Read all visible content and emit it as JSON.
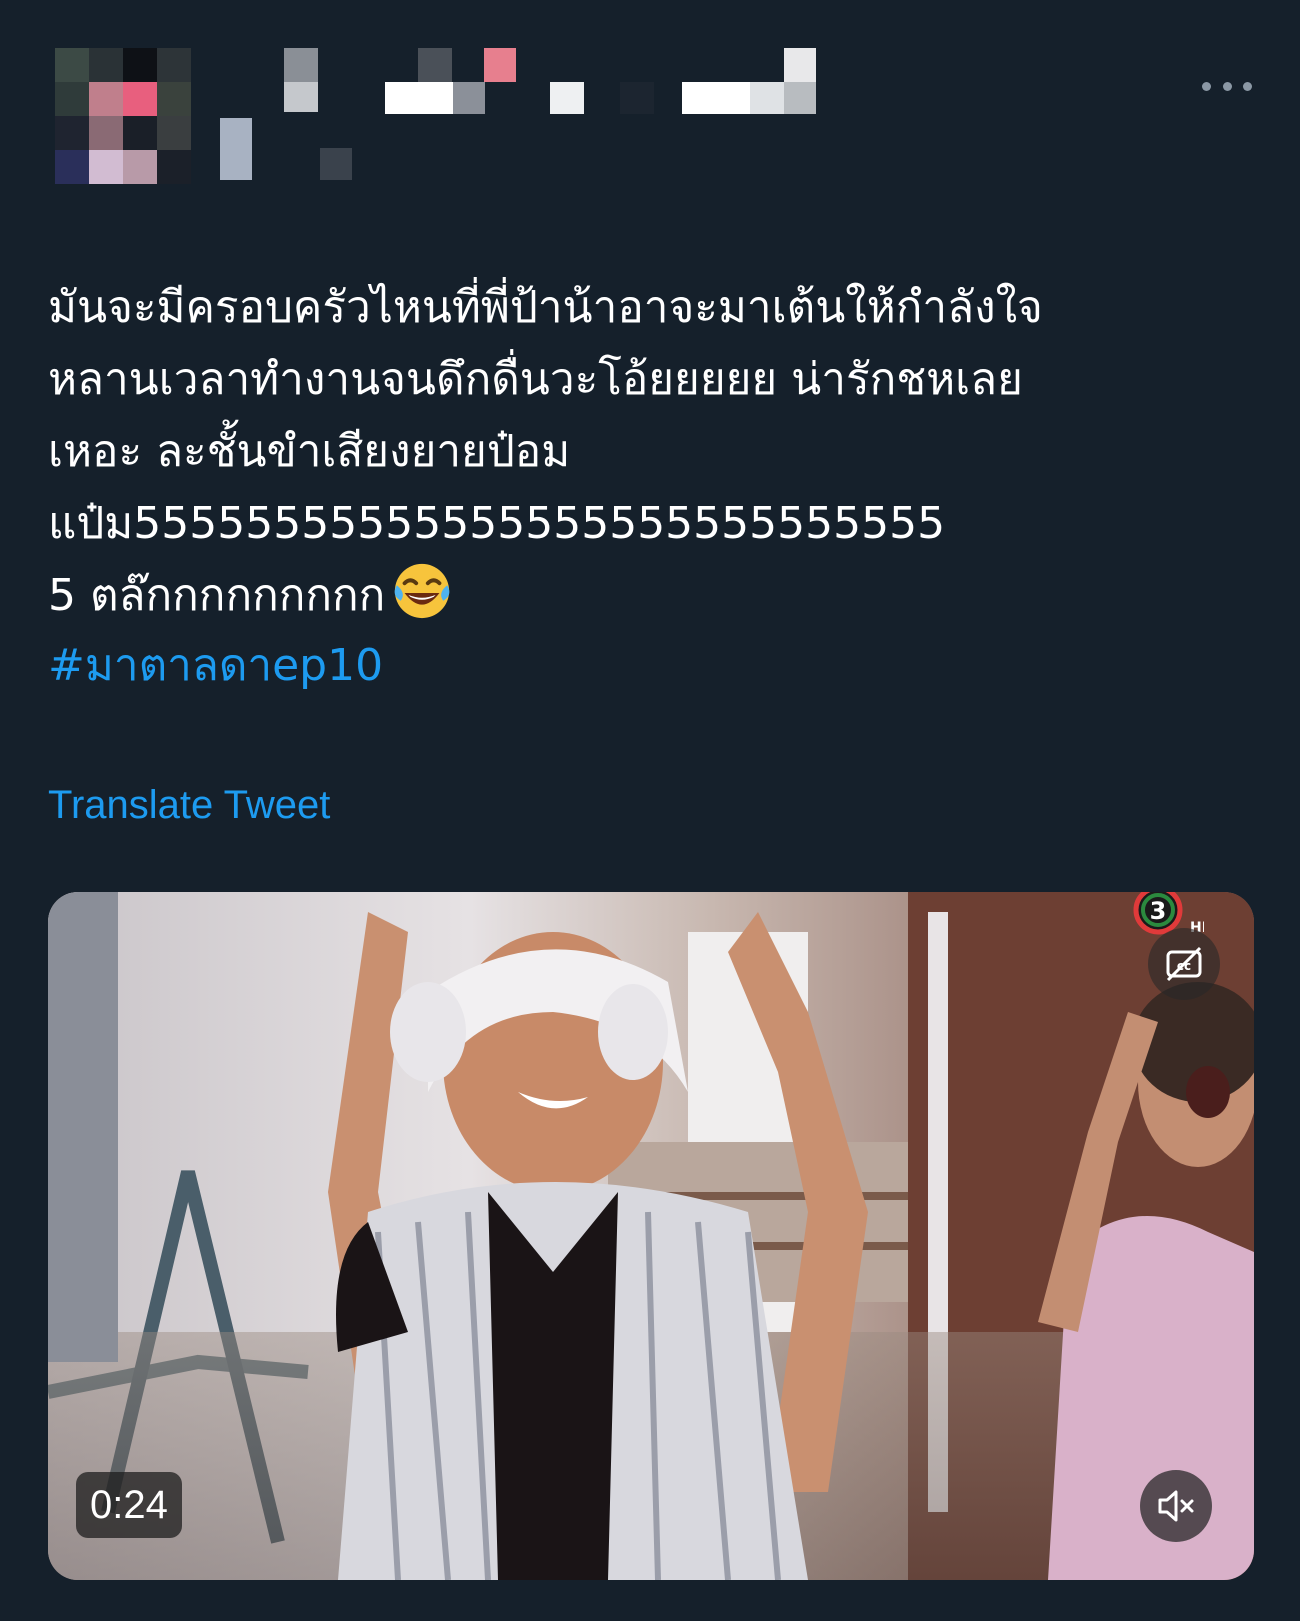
{
  "tweet": {
    "text": "มันจะมีครอบครัวไหนที่พี่ป้าน้าอาจะมาเต้นให้กำลังใจ\nหลานเวลาทำงานจนดึกดื่นวะโอ้ยยยยย น่ารักชหเลย\nเหอะ ละชั้นขำเสียงยายป๋อม\nแป๋ม55555555555555555555555555555\n5 ตล๊กกกกกกกกก",
    "emoji": "face-with-tears-of-joy",
    "hashtag": "#มาตาลดาep10",
    "translate_label": "Translate Tweet",
    "more_icon": "more-horizontal-icon"
  },
  "video": {
    "timestamp": "0:24",
    "channel_logo": "channel-3-logo",
    "cc_icon": "captions-off-icon",
    "mute_icon": "volume-muted-icon"
  },
  "colors": {
    "background": "#15202b",
    "text": "#ffffff",
    "link": "#1d9bf0",
    "muted": "#8b98a5"
  }
}
